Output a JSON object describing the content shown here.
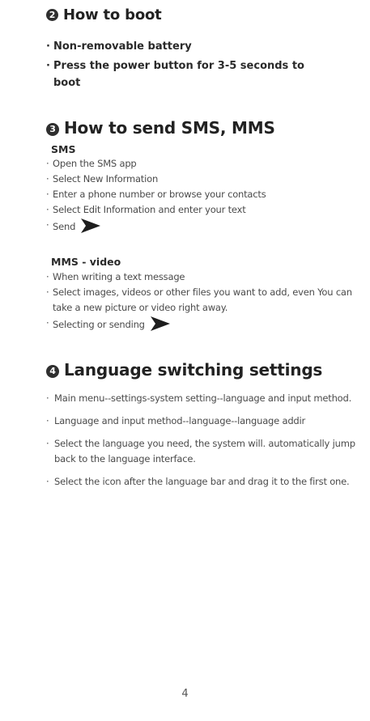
{
  "section_boot": {
    "number": "2",
    "title": "How to boot",
    "items": [
      "Non-removable battery",
      "Press the power button for 3-5 seconds to boot"
    ]
  },
  "section_sms": {
    "number": "3",
    "title": "How to send SMS, MMS",
    "sms": {
      "heading": "SMS",
      "steps": [
        "Open the SMS app",
        "Select New Information",
        "Enter a phone number or browse your contacts",
        "Select Edit Information and enter your text",
        "Send"
      ]
    },
    "mms": {
      "heading": "MMS - video",
      "steps": [
        "When writing a text message",
        "Select images, videos or other files you want to add, even You can take a new picture or video right away.",
        "Selecting or sending"
      ]
    }
  },
  "section_language": {
    "number": "4",
    "title": "Language switching settings",
    "items": [
      "Main menu--settings-system setting--language and input method.",
      "Language and input method--language--language addir",
      "Select the language you need, the system will. automatically jump back to the language interface.",
      "Select the icon after the language bar and drag it to the first one."
    ]
  },
  "page_number": "4",
  "icons": {
    "send": "send-arrow-icon"
  }
}
